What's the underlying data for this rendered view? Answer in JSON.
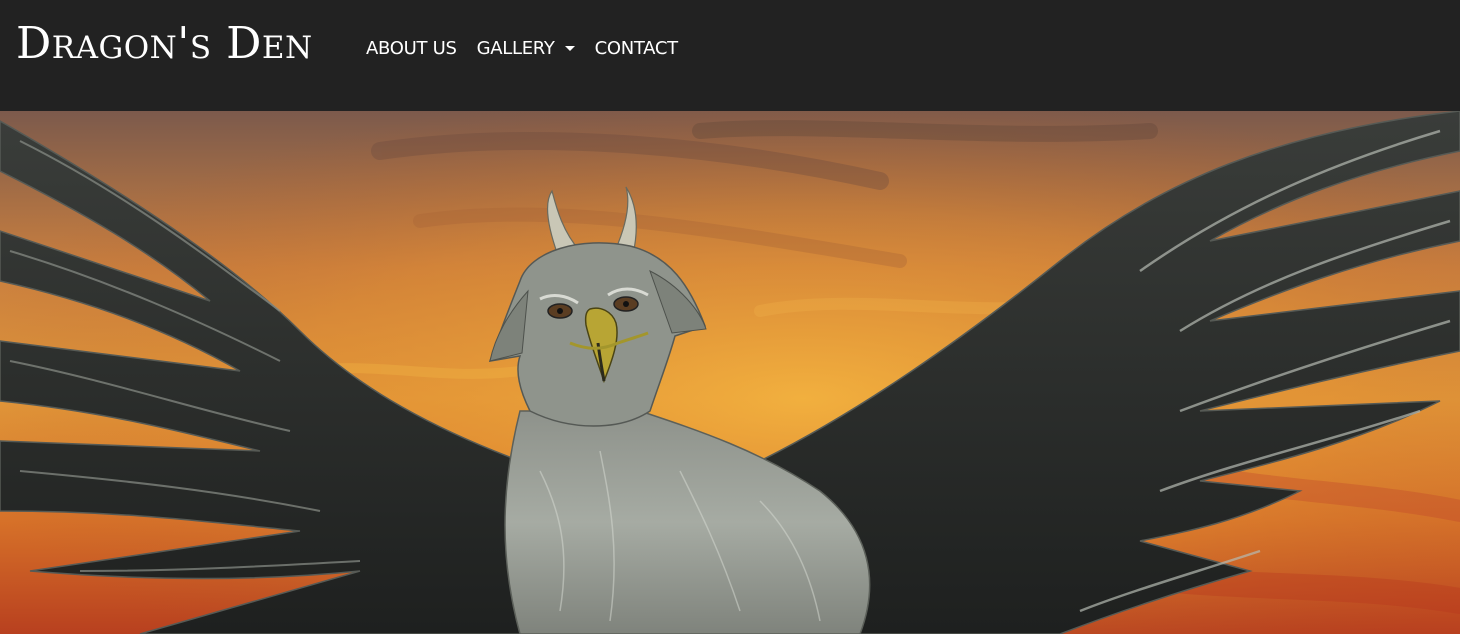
{
  "brand": {
    "title": "Dragon's Den"
  },
  "nav": {
    "items": [
      {
        "label": "ABOUT US",
        "has_dropdown": false
      },
      {
        "label": "GALLERY",
        "has_dropdown": true
      },
      {
        "label": "CONTACT",
        "has_dropdown": false
      }
    ]
  },
  "hero": {
    "subject": "painted gryphon with spread dark wings against an orange sunset sky"
  },
  "colors": {
    "navbar_bg": "#222222",
    "nav_text": "#ffffff",
    "sky_orange": "#e39a3a",
    "sky_red": "#b8401f",
    "feather_dark": "#2a2c2a",
    "feather_grey": "#9ea39c"
  }
}
